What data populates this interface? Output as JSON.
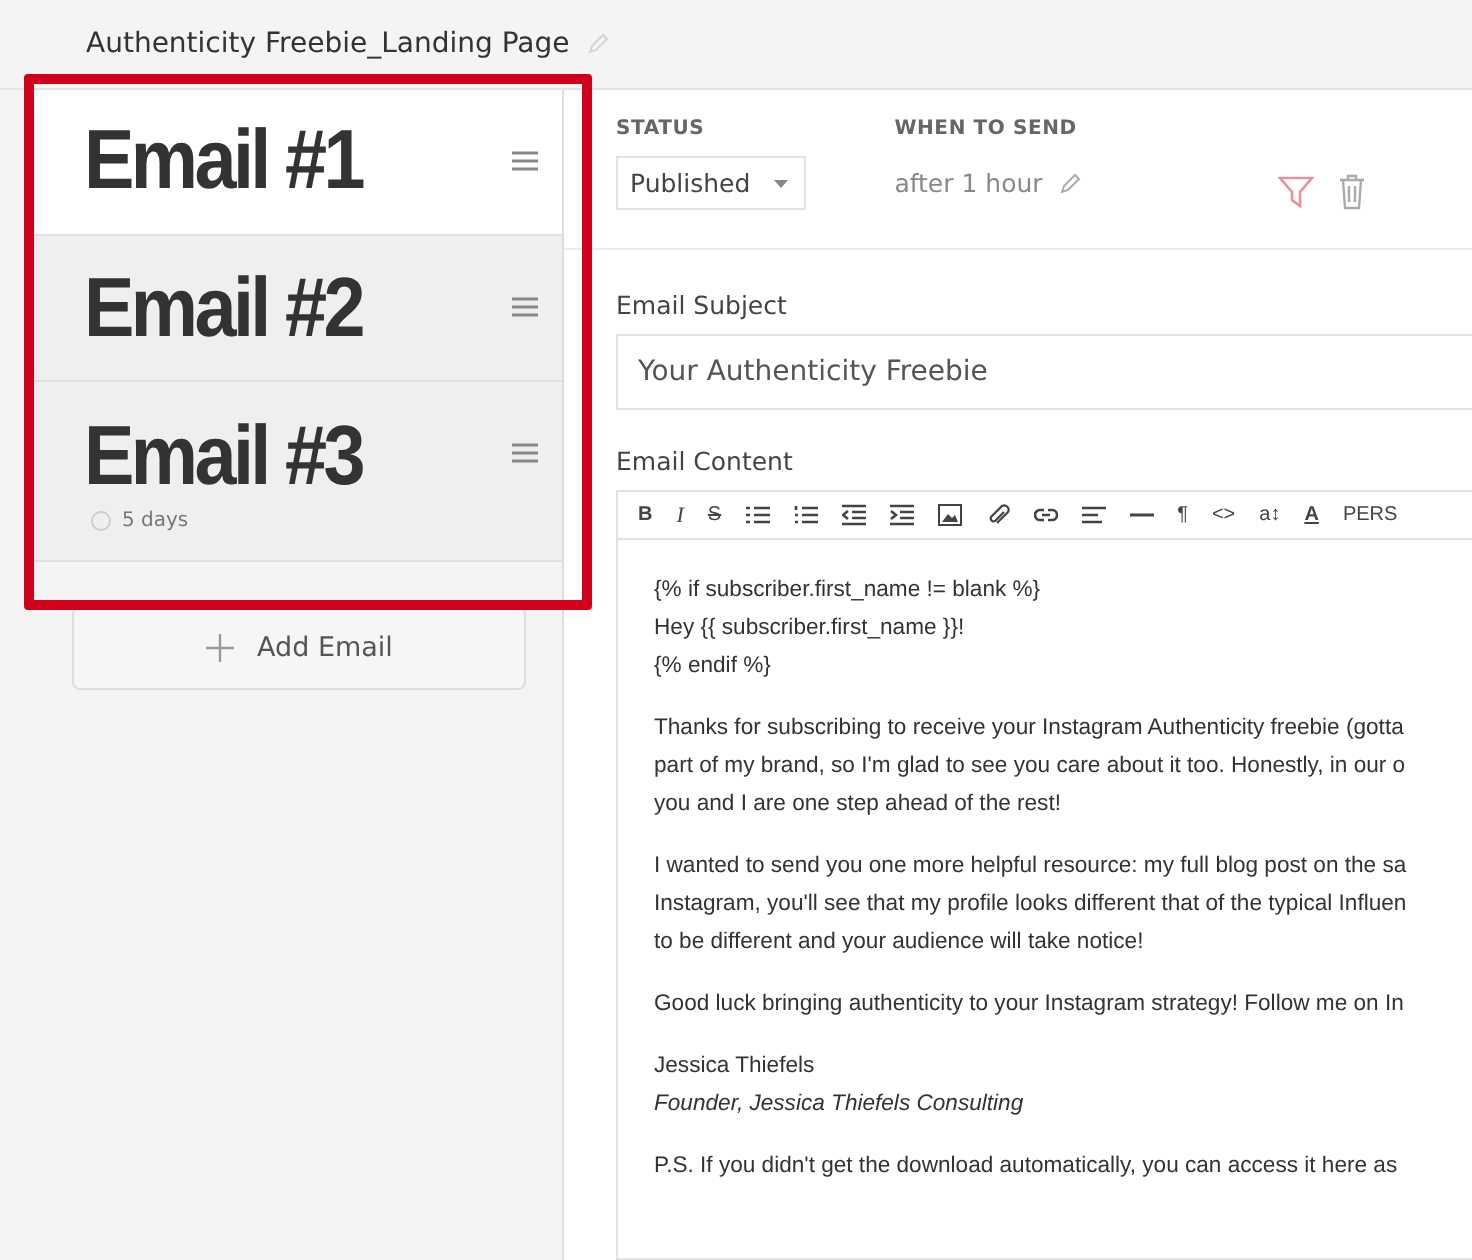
{
  "page_title": "Authenticity Freebie_Landing Page",
  "emails": [
    {
      "annotation": "Email #1",
      "selected": true
    },
    {
      "annotation": "Email #2",
      "selected": false
    },
    {
      "annotation": "Email #3",
      "selected": false,
      "delay": "5 days"
    }
  ],
  "add_email": "Add Email",
  "status": {
    "label": "STATUS",
    "value": "Published"
  },
  "when_to_send": {
    "label": "WHEN TO SEND",
    "value": "after 1 hour"
  },
  "subject": {
    "label": "Email Subject",
    "value": "Your Authenticity Freebie"
  },
  "content": {
    "label": "Email Content",
    "toolbar": [
      {
        "kind": "bold",
        "label": "B"
      },
      {
        "kind": "italic",
        "label": "I"
      },
      {
        "kind": "strike",
        "label": "S"
      },
      {
        "kind": "bullets"
      },
      {
        "kind": "numbers"
      },
      {
        "kind": "outdent"
      },
      {
        "kind": "indent"
      },
      {
        "kind": "image"
      },
      {
        "kind": "attach"
      },
      {
        "kind": "link"
      },
      {
        "kind": "align"
      },
      {
        "kind": "rule"
      },
      {
        "kind": "text",
        "label": "¶"
      },
      {
        "kind": "text",
        "label": "<>"
      },
      {
        "kind": "text",
        "label": "a↕"
      },
      {
        "kind": "underline",
        "label": "A"
      },
      {
        "kind": "text",
        "label": "PERS"
      }
    ],
    "paragraphs": [
      {
        "kind": "plain",
        "lines": [
          "{% if subscriber.first_name != blank %}",
          "Hey {{ subscriber.first_name }}!",
          "{% endif %}"
        ]
      },
      {
        "kind": "plain",
        "lines": [
          "Thanks for subscribing to receive your Instagram Authenticity freebie (gotta",
          "part of my brand, so I'm glad to see you care about it too. Honestly, in our o",
          "you and I are one step ahead of the rest!"
        ]
      },
      {
        "kind": "plain",
        "lines": [
          "I wanted to send you one more helpful resource: my full blog post on the sa",
          "Instagram, you'll see that my profile looks different that of the typical Influen",
          "to be different and your audience will take notice!"
        ]
      },
      {
        "kind": "plain",
        "lines": [
          "Good luck bringing authenticity to your Instagram strategy! Follow me on In"
        ]
      },
      {
        "kind": "signature",
        "lines": [
          "Jessica Thiefels",
          "Founder, Jessica Thiefels Consulting"
        ]
      },
      {
        "kind": "plain",
        "lines": [
          "P.S. If you didn't get the download automatically, you can access it here as"
        ]
      }
    ]
  }
}
